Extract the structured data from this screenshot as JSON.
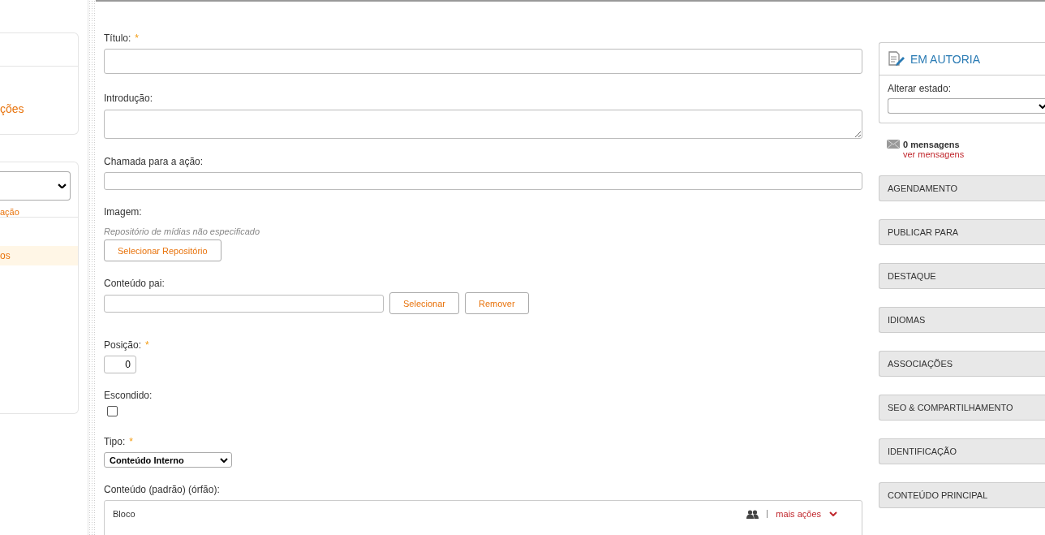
{
  "sidebar": {
    "top_link": "ções",
    "select_link": "ação",
    "items": [
      {
        "label": "os",
        "selected": true
      }
    ]
  },
  "form": {
    "fields": [
      {
        "kind": "title",
        "label": "Título:",
        "required_mark": "*"
      },
      {
        "kind": "textarea",
        "label": "Introdução:"
      },
      {
        "kind": "text",
        "label": "Chamada para a ação:"
      },
      {
        "kind": "media",
        "label": "Imagem:",
        "note": "Repositório de mídias não especificado",
        "button": "Selecionar Repositório"
      },
      {
        "kind": "reference",
        "label": "Conteúdo pai:",
        "buttons": [
          "Selecionar",
          "Remover"
        ]
      },
      {
        "kind": "number",
        "label": "Posição:",
        "required_mark": "*",
        "value": "0"
      },
      {
        "kind": "checkbox",
        "label": "Escondido:",
        "checked": false
      },
      {
        "kind": "select",
        "label": "Tipo:",
        "required_mark": "*",
        "value": "Conteúdo Interno"
      },
      {
        "kind": "blocks",
        "label": "Conteúdo (padrão) (órfão):",
        "block": "Bloco",
        "actions": "mais ações"
      }
    ]
  },
  "workflow": {
    "state": "EM AUTORIA",
    "change_label": "Alterar estado:"
  },
  "messages": {
    "count": "0 mensagens",
    "link": "ver mensagens"
  },
  "sections": [
    "AGENDAMENTO",
    "PUBLICAR PARA",
    "DESTAQUE",
    "IDIOMAS",
    "ASSOCIAÇÕES",
    "SEO & COMPARTILHAMENTO",
    "IDENTIFICAÇÃO",
    "CONTEÚDO PRINCIPAL"
  ]
}
